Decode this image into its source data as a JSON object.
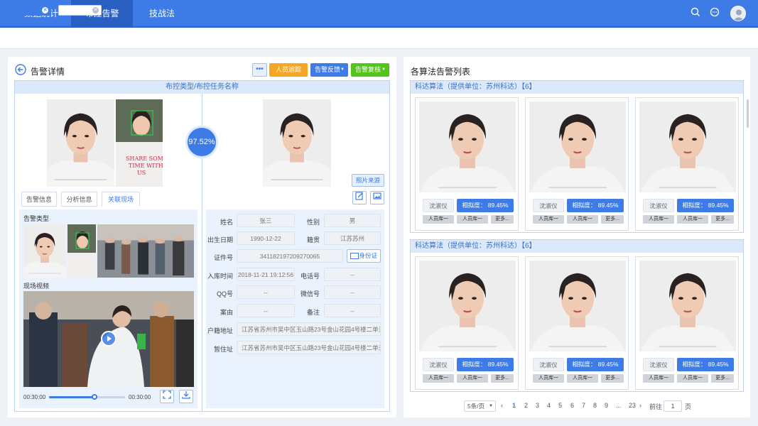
{
  "nav": {
    "items": [
      "数据统计",
      "布控告警",
      "技战法"
    ],
    "active_index": 1
  },
  "header_icons": [
    "search-icon",
    "chat-icon",
    "user-avatar"
  ],
  "left": {
    "title": "告警详情",
    "more": "•••",
    "btn_track": "人员追踪",
    "btn_feedback": "告警反馈",
    "btn_review": "告警复核",
    "task_title": "布控类型/布控任务名称",
    "similarity": "97.52%",
    "photo_source": "照片来源",
    "tabs": [
      "告警信息",
      "分析信息",
      "关联现场"
    ],
    "active_tab": 2,
    "alarm_type_label": "告警类型",
    "video_label": "现场视频",
    "video_time_start": "00:30:00",
    "video_time_end": "00:30:00",
    "video_progress": 0.6,
    "info": {
      "name_l": "姓名",
      "name": "张三",
      "gender_l": "性别",
      "gender": "男",
      "dob_l": "出生日期",
      "dob": "1990-12-22",
      "native_l": "籍贯",
      "native": "江苏苏州",
      "id_l": "证件号",
      "id": "341182197209270065",
      "id_btn": "身份证",
      "entry_l": "入库时间",
      "entry": "2018-11-21 19:12:56",
      "phone_l": "电话号",
      "phone": "--",
      "qq_l": "QQ号",
      "qq": "--",
      "wechat_l": "微信号",
      "wechat": "--",
      "case_l": "案由",
      "case": "--",
      "remark_l": "备注",
      "remark": "--",
      "hukou_l": "户籍地址",
      "hukou": "江苏省苏州市吴中区玉山路23号金山花园4号楼二单元...",
      "temp_l": "暂住址",
      "temp": "江苏省苏州市吴中区玉山路23号金山花园4号楼二单元..."
    }
  },
  "right": {
    "title": "各算法告警列表",
    "groups": [
      {
        "title": "科达算法（提供单位：苏州科达）【6】"
      },
      {
        "title": "科达算法（提供单位：苏州科达）【6】"
      }
    ],
    "card": {
      "name": "沈淑仪",
      "sim": "相拟度：  89.45%",
      "b1": "人员库一",
      "b2": "人员库一",
      "b3": "更多..."
    },
    "pagination": {
      "per_page": "5条/页",
      "prev": "‹",
      "pages": [
        "1",
        "2",
        "3",
        "4",
        "5",
        "6",
        "7",
        "8",
        "9",
        "...",
        "23"
      ],
      "current": "1",
      "next": "›",
      "goto_before": "前往",
      "goto_value": "1",
      "goto_after": "页"
    }
  },
  "colors": {
    "primary": "#3d7ce6",
    "orange": "#f5a623",
    "green": "#52c41a"
  }
}
